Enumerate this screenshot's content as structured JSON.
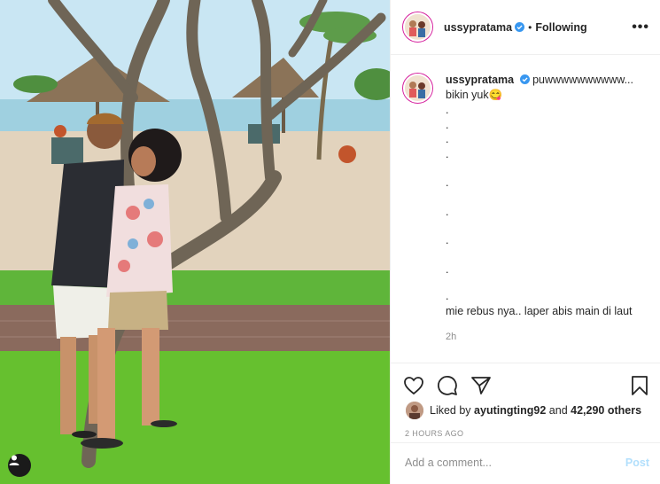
{
  "post": {
    "username": "ussypratama",
    "separator": "•",
    "follow_status": "Following",
    "more_label": "•••"
  },
  "caption": {
    "username": "ussypratama",
    "first_line": "puwwwwwwwwww...",
    "second_line": "bikin yuk😋",
    "dots": [
      ".",
      ".",
      ".",
      ".",
      ".",
      ".",
      ".",
      ".",
      "."
    ],
    "last_line": "mie rebus nya.. laper abis main di laut",
    "time": "2h"
  },
  "likes": {
    "prefix": "Liked by",
    "user": "ayutingting92",
    "middle": "and",
    "count": "42,290 others"
  },
  "date": "2 HOURS AGO",
  "comment_box": {
    "placeholder": "Add a comment...",
    "post_label": "Post"
  },
  "icons": {
    "like": "heart-icon",
    "comment": "comment-icon",
    "share": "share-icon",
    "save": "bookmark-icon",
    "tag": "user-tag-icon",
    "verified": "verified-badge-icon"
  },
  "colors": {
    "verified_blue": "#3897f0",
    "post_button": "#b2dffc",
    "muted_text": "#8e8e8e",
    "border": "#efefef"
  }
}
